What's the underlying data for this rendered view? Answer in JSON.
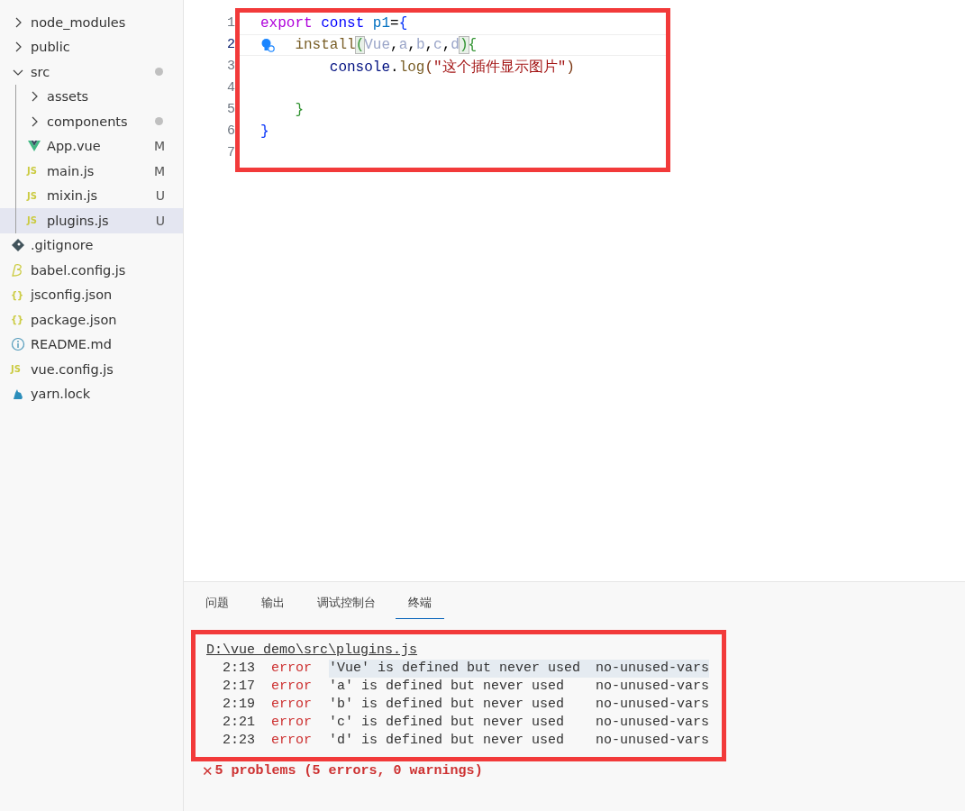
{
  "explorer": {
    "items": [
      {
        "name": "node_modules",
        "kind": "folder",
        "expanded": false,
        "selected": false,
        "dirty": false
      },
      {
        "name": "public",
        "kind": "folder",
        "expanded": false,
        "selected": false,
        "dirty": false
      },
      {
        "name": "src",
        "kind": "folder",
        "expanded": true,
        "selected": false,
        "dirty": true,
        "children": [
          {
            "name": "assets",
            "kind": "folder",
            "expanded": false,
            "selected": false,
            "dirty": false
          },
          {
            "name": "components",
            "kind": "folder",
            "expanded": false,
            "selected": false,
            "dirty": true
          },
          {
            "name": "App.vue",
            "kind": "vue",
            "selected": false,
            "badge": "M"
          },
          {
            "name": "main.js",
            "kind": "text-icon",
            "icon": "JS",
            "selected": false,
            "badge": "M"
          },
          {
            "name": "mixin.js",
            "kind": "text-icon",
            "icon": "JS",
            "selected": false,
            "badge": "U"
          },
          {
            "name": "plugins.js",
            "kind": "text-icon",
            "icon": "JS",
            "selected": true,
            "badge": "U"
          }
        ]
      },
      {
        "name": ".gitignore",
        "kind": "git",
        "selected": false
      },
      {
        "name": "babel.config.js",
        "kind": "babel",
        "selected": false
      },
      {
        "name": "jsconfig.json",
        "kind": "text-icon",
        "icon": "{}",
        "selected": false
      },
      {
        "name": "package.json",
        "kind": "text-icon",
        "icon": "{}",
        "selected": false
      },
      {
        "name": "README.md",
        "kind": "info",
        "selected": false
      },
      {
        "name": "vue.config.js",
        "kind": "text-icon",
        "icon": "JS",
        "selected": false
      },
      {
        "name": "yarn.lock",
        "kind": "yarn",
        "selected": false
      }
    ]
  },
  "editor": {
    "lines": [
      {
        "number": "1",
        "current": false,
        "tokens": [
          {
            "text": "export ",
            "kind": "control"
          },
          {
            "text": "const ",
            "kind": "storage"
          },
          {
            "text": "p1",
            "kind": "constant"
          },
          {
            "text": "=",
            "kind": "plain"
          },
          {
            "text": "{",
            "kind": "brace"
          }
        ]
      },
      {
        "number": "2",
        "current": true,
        "lightbulb": true,
        "tokens": [
          {
            "text": "    install",
            "kind": "function"
          },
          {
            "text": "(",
            "kind": "matched"
          },
          {
            "text": "Vue",
            "kind": "unused"
          },
          {
            "text": ",",
            "kind": "plain"
          },
          {
            "text": "a",
            "kind": "unused"
          },
          {
            "text": ",",
            "kind": "plain"
          },
          {
            "text": "b",
            "kind": "unused"
          },
          {
            "text": ",",
            "kind": "plain"
          },
          {
            "text": "c",
            "kind": "unused"
          },
          {
            "text": ",",
            "kind": "plain"
          },
          {
            "text": "d",
            "kind": "unused"
          },
          {
            "text": ")",
            "kind": "matched"
          },
          {
            "text": "{",
            "kind": "brace2"
          }
        ]
      },
      {
        "number": "3",
        "current": false,
        "tokens": [
          {
            "text": "        console",
            "kind": "variable"
          },
          {
            "text": ".",
            "kind": "plain"
          },
          {
            "text": "log",
            "kind": "function"
          },
          {
            "text": "(",
            "kind": "paren"
          },
          {
            "text": "\"这个插件显示图片\"",
            "kind": "string"
          },
          {
            "text": ")",
            "kind": "paren"
          }
        ]
      },
      {
        "number": "4",
        "current": false
      },
      {
        "number": "5",
        "current": false,
        "tokens": [
          {
            "text": "    }",
            "kind": "brace2"
          }
        ]
      },
      {
        "number": "6",
        "current": false,
        "tokens": [
          {
            "text": "}",
            "kind": "brace"
          }
        ]
      },
      {
        "number": "7",
        "current": false
      }
    ]
  },
  "panel": {
    "tabs": [
      {
        "label": "问题",
        "selected": false
      },
      {
        "label": "输出",
        "selected": false
      },
      {
        "label": "调试控制台",
        "selected": false
      },
      {
        "label": "终端",
        "selected": true
      }
    ],
    "terminal": {
      "path": "D:\\vue demo\\src\\plugins.js",
      "problems": [
        {
          "position": "2:13",
          "severity": "error",
          "message": "'Vue' is defined but never used",
          "rule": "no-unused-vars",
          "highlighted": true
        },
        {
          "position": "2:17",
          "severity": "error",
          "message": "'a' is defined but never used",
          "rule": "no-unused-vars",
          "highlighted": false
        },
        {
          "position": "2:19",
          "severity": "error",
          "message": "'b' is defined but never used",
          "rule": "no-unused-vars",
          "highlighted": false
        },
        {
          "position": "2:21",
          "severity": "error",
          "message": "'c' is defined but never used",
          "rule": "no-unused-vars",
          "highlighted": false
        },
        {
          "position": "2:23",
          "severity": "error",
          "message": "'d' is defined but never used",
          "rule": "no-unused-vars",
          "highlighted": false
        }
      ],
      "summary_icon": "✕",
      "summary": "5 problems (5 errors, 0 warnings)"
    }
  }
}
